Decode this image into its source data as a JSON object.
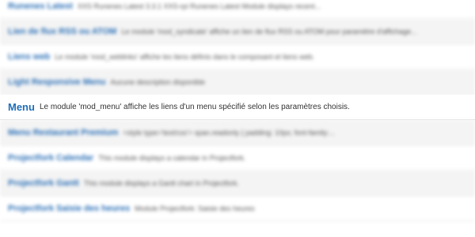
{
  "modules": [
    {
      "name": "Runenes Latest",
      "description": "XXS Runenes Latest 3.3.1 XXS-rpi Runenes Latest Module displays recent..."
    },
    {
      "name": "Lien de flux RSS ou ATOM",
      "description": "Le module 'mod_syndicate' affiche un lien de flux RSS ou ATOM pour paramètre d'affichage..."
    },
    {
      "name": "Liens web",
      "description": "Le module 'mod_weblinks' affiche les liens définis dans le composant et liens web."
    },
    {
      "name": "Light Responsive Menu",
      "description": "Aucune description disponible"
    },
    {
      "name": "Menu",
      "description": "Le module 'mod_menu' affiche les liens d'un menu spécifié selon les paramètres choisis."
    },
    {
      "name": "Menu Restaurant Premium",
      "description": "<style type='text/css'> span.readonly { padding: 10px; font-family:..."
    },
    {
      "name": "Projectfork Calendar",
      "description": "This module displays a calendar in Projectfork."
    },
    {
      "name": "Projectfork Gantt",
      "description": "This module displays a Gantt chart in Projectfork."
    },
    {
      "name": "Projectfork Saisie des heures",
      "description": "Module Projectfork: Saisie des heures"
    }
  ]
}
